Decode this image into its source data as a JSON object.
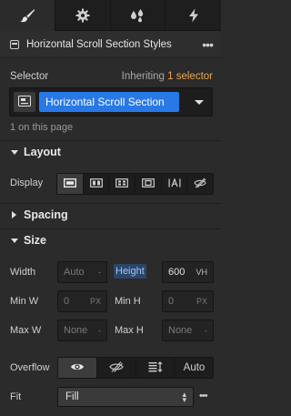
{
  "tabs": [
    {
      "icon": "paintbrush-icon",
      "active": true
    },
    {
      "icon": "gear-icon",
      "active": false
    },
    {
      "icon": "droplets-icon",
      "active": false
    },
    {
      "icon": "lightning-icon",
      "active": false
    }
  ],
  "header": {
    "title": "Horizontal Scroll Section Styles",
    "more": "•••"
  },
  "selector": {
    "label": "Selector",
    "inheriting_prefix": "Inheriting ",
    "inheriting_link": "1 selector",
    "chip": "Horizontal Scroll Section",
    "count": "1 on this page"
  },
  "sections": {
    "layout": "Layout",
    "spacing": "Spacing",
    "size": "Size"
  },
  "display": {
    "label": "Display",
    "options": [
      "block",
      "flex",
      "grid",
      "inline-block",
      "inline",
      "none"
    ],
    "active": "block"
  },
  "size": {
    "width_label": "Width",
    "width_value": "Auto",
    "width_unit": "-",
    "height_label": "Height",
    "height_value": "600",
    "height_unit": "VH",
    "minw_label": "Min W",
    "minw_value": "0",
    "minw_unit": "PX",
    "minh_label": "Min H",
    "minh_value": "0",
    "minh_unit": "PX",
    "maxw_label": "Max W",
    "maxw_value": "None",
    "maxw_unit": "-",
    "maxh_label": "Max H",
    "maxh_value": "None",
    "maxh_unit": "-"
  },
  "overflow": {
    "label": "Overflow",
    "auto_label": "Auto",
    "active": "visible"
  },
  "fit": {
    "label": "Fit",
    "value": "Fill",
    "more": "•••"
  },
  "colors": {
    "accent_blue": "#2879e6",
    "link_orange": "#f0a64e",
    "panel_bg": "#2b2b2b"
  }
}
